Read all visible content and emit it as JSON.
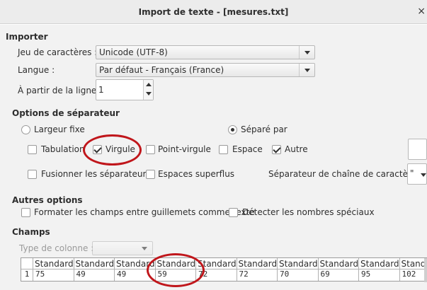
{
  "window": {
    "title": "Import de texte - [mesures.txt]",
    "close_glyph": "×"
  },
  "import": {
    "heading": "Importer",
    "charset_label": "Jeu de caractères :",
    "charset_value": "Unicode (UTF-8)",
    "language_label": "Langue :",
    "language_value": "Par défaut - Français (France)",
    "from_line_label": "À partir de la ligne :",
    "from_line_value": "1"
  },
  "separator": {
    "heading": "Options de séparateur",
    "fixed_width": {
      "label": "Largeur fixe",
      "selected": false
    },
    "separated_by": {
      "label": "Séparé par",
      "selected": true
    },
    "tab": {
      "label": "Tabulation",
      "checked": false
    },
    "comma": {
      "label": "Virgule",
      "checked": true
    },
    "semicolon": {
      "label": "Point-virgule",
      "checked": false
    },
    "space": {
      "label": "Espace",
      "checked": false
    },
    "other": {
      "label": "Autre",
      "checked": true,
      "value": ""
    },
    "merge": {
      "label": "Fusionner les séparateurs",
      "checked": false
    },
    "trim": {
      "label": "Espaces superflus",
      "checked": false
    },
    "string_delim_label": "Séparateur de chaîne de caractères :",
    "string_delim_value": "\""
  },
  "other_options": {
    "heading": "Autres options",
    "quoted_as_text": {
      "label": "Formater les champs entre guillemets comme texte",
      "checked": false
    },
    "special_numbers": {
      "label": "Détecter les nombres spéciaux",
      "checked": false
    }
  },
  "fields": {
    "heading": "Champs",
    "column_type_label": "Type de colonne :",
    "column_type_value": "",
    "row_number": "1",
    "columns": [
      {
        "header": "Standard",
        "value": "75"
      },
      {
        "header": "Standard",
        "value": "49"
      },
      {
        "header": "Standard",
        "value": "49"
      },
      {
        "header": "Standard",
        "value": "59"
      },
      {
        "header": "Standard",
        "value": "72"
      },
      {
        "header": "Standard",
        "value": "72"
      },
      {
        "header": "Standard",
        "value": "70"
      },
      {
        "header": "Standard",
        "value": "69"
      },
      {
        "header": "Standard",
        "value": "95"
      },
      {
        "header": "Standard",
        "value": "102"
      }
    ]
  },
  "annotation_color": "#c0161b"
}
